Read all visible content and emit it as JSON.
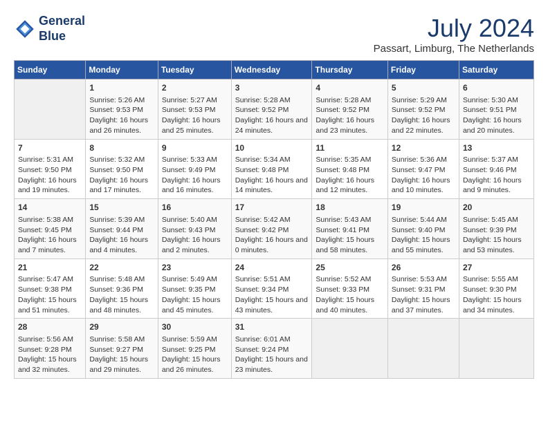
{
  "header": {
    "logo_line1": "General",
    "logo_line2": "Blue",
    "month_year": "July 2024",
    "location": "Passart, Limburg, The Netherlands"
  },
  "weekdays": [
    "Sunday",
    "Monday",
    "Tuesday",
    "Wednesday",
    "Thursday",
    "Friday",
    "Saturday"
  ],
  "weeks": [
    [
      {
        "day": "",
        "sunrise": "",
        "sunset": "",
        "daylight": ""
      },
      {
        "day": "1",
        "sunrise": "Sunrise: 5:26 AM",
        "sunset": "Sunset: 9:53 PM",
        "daylight": "Daylight: 16 hours and 26 minutes."
      },
      {
        "day": "2",
        "sunrise": "Sunrise: 5:27 AM",
        "sunset": "Sunset: 9:53 PM",
        "daylight": "Daylight: 16 hours and 25 minutes."
      },
      {
        "day": "3",
        "sunrise": "Sunrise: 5:28 AM",
        "sunset": "Sunset: 9:52 PM",
        "daylight": "Daylight: 16 hours and 24 minutes."
      },
      {
        "day": "4",
        "sunrise": "Sunrise: 5:28 AM",
        "sunset": "Sunset: 9:52 PM",
        "daylight": "Daylight: 16 hours and 23 minutes."
      },
      {
        "day": "5",
        "sunrise": "Sunrise: 5:29 AM",
        "sunset": "Sunset: 9:52 PM",
        "daylight": "Daylight: 16 hours and 22 minutes."
      },
      {
        "day": "6",
        "sunrise": "Sunrise: 5:30 AM",
        "sunset": "Sunset: 9:51 PM",
        "daylight": "Daylight: 16 hours and 20 minutes."
      }
    ],
    [
      {
        "day": "7",
        "sunrise": "Sunrise: 5:31 AM",
        "sunset": "Sunset: 9:50 PM",
        "daylight": "Daylight: 16 hours and 19 minutes."
      },
      {
        "day": "8",
        "sunrise": "Sunrise: 5:32 AM",
        "sunset": "Sunset: 9:50 PM",
        "daylight": "Daylight: 16 hours and 17 minutes."
      },
      {
        "day": "9",
        "sunrise": "Sunrise: 5:33 AM",
        "sunset": "Sunset: 9:49 PM",
        "daylight": "Daylight: 16 hours and 16 minutes."
      },
      {
        "day": "10",
        "sunrise": "Sunrise: 5:34 AM",
        "sunset": "Sunset: 9:48 PM",
        "daylight": "Daylight: 16 hours and 14 minutes."
      },
      {
        "day": "11",
        "sunrise": "Sunrise: 5:35 AM",
        "sunset": "Sunset: 9:48 PM",
        "daylight": "Daylight: 16 hours and 12 minutes."
      },
      {
        "day": "12",
        "sunrise": "Sunrise: 5:36 AM",
        "sunset": "Sunset: 9:47 PM",
        "daylight": "Daylight: 16 hours and 10 minutes."
      },
      {
        "day": "13",
        "sunrise": "Sunrise: 5:37 AM",
        "sunset": "Sunset: 9:46 PM",
        "daylight": "Daylight: 16 hours and 9 minutes."
      }
    ],
    [
      {
        "day": "14",
        "sunrise": "Sunrise: 5:38 AM",
        "sunset": "Sunset: 9:45 PM",
        "daylight": "Daylight: 16 hours and 7 minutes."
      },
      {
        "day": "15",
        "sunrise": "Sunrise: 5:39 AM",
        "sunset": "Sunset: 9:44 PM",
        "daylight": "Daylight: 16 hours and 4 minutes."
      },
      {
        "day": "16",
        "sunrise": "Sunrise: 5:40 AM",
        "sunset": "Sunset: 9:43 PM",
        "daylight": "Daylight: 16 hours and 2 minutes."
      },
      {
        "day": "17",
        "sunrise": "Sunrise: 5:42 AM",
        "sunset": "Sunset: 9:42 PM",
        "daylight": "Daylight: 16 hours and 0 minutes."
      },
      {
        "day": "18",
        "sunrise": "Sunrise: 5:43 AM",
        "sunset": "Sunset: 9:41 PM",
        "daylight": "Daylight: 15 hours and 58 minutes."
      },
      {
        "day": "19",
        "sunrise": "Sunrise: 5:44 AM",
        "sunset": "Sunset: 9:40 PM",
        "daylight": "Daylight: 15 hours and 55 minutes."
      },
      {
        "day": "20",
        "sunrise": "Sunrise: 5:45 AM",
        "sunset": "Sunset: 9:39 PM",
        "daylight": "Daylight: 15 hours and 53 minutes."
      }
    ],
    [
      {
        "day": "21",
        "sunrise": "Sunrise: 5:47 AM",
        "sunset": "Sunset: 9:38 PM",
        "daylight": "Daylight: 15 hours and 51 minutes."
      },
      {
        "day": "22",
        "sunrise": "Sunrise: 5:48 AM",
        "sunset": "Sunset: 9:36 PM",
        "daylight": "Daylight: 15 hours and 48 minutes."
      },
      {
        "day": "23",
        "sunrise": "Sunrise: 5:49 AM",
        "sunset": "Sunset: 9:35 PM",
        "daylight": "Daylight: 15 hours and 45 minutes."
      },
      {
        "day": "24",
        "sunrise": "Sunrise: 5:51 AM",
        "sunset": "Sunset: 9:34 PM",
        "daylight": "Daylight: 15 hours and 43 minutes."
      },
      {
        "day": "25",
        "sunrise": "Sunrise: 5:52 AM",
        "sunset": "Sunset: 9:33 PM",
        "daylight": "Daylight: 15 hours and 40 minutes."
      },
      {
        "day": "26",
        "sunrise": "Sunrise: 5:53 AM",
        "sunset": "Sunset: 9:31 PM",
        "daylight": "Daylight: 15 hours and 37 minutes."
      },
      {
        "day": "27",
        "sunrise": "Sunrise: 5:55 AM",
        "sunset": "Sunset: 9:30 PM",
        "daylight": "Daylight: 15 hours and 34 minutes."
      }
    ],
    [
      {
        "day": "28",
        "sunrise": "Sunrise: 5:56 AM",
        "sunset": "Sunset: 9:28 PM",
        "daylight": "Daylight: 15 hours and 32 minutes."
      },
      {
        "day": "29",
        "sunrise": "Sunrise: 5:58 AM",
        "sunset": "Sunset: 9:27 PM",
        "daylight": "Daylight: 15 hours and 29 minutes."
      },
      {
        "day": "30",
        "sunrise": "Sunrise: 5:59 AM",
        "sunset": "Sunset: 9:25 PM",
        "daylight": "Daylight: 15 hours and 26 minutes."
      },
      {
        "day": "31",
        "sunrise": "Sunrise: 6:01 AM",
        "sunset": "Sunset: 9:24 PM",
        "daylight": "Daylight: 15 hours and 23 minutes."
      },
      {
        "day": "",
        "sunrise": "",
        "sunset": "",
        "daylight": ""
      },
      {
        "day": "",
        "sunrise": "",
        "sunset": "",
        "daylight": ""
      },
      {
        "day": "",
        "sunrise": "",
        "sunset": "",
        "daylight": ""
      }
    ]
  ]
}
